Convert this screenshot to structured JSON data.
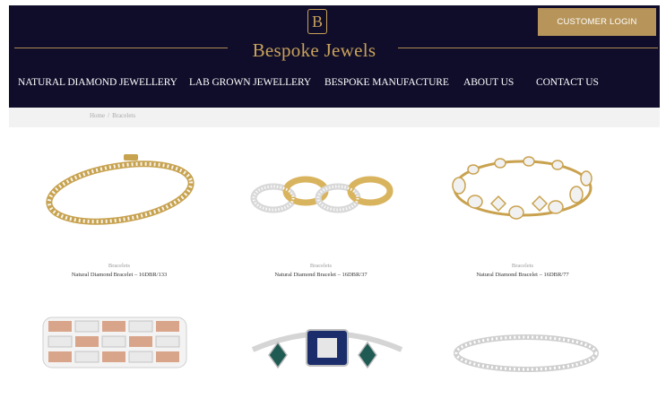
{
  "header": {
    "logo_letter": "B",
    "brand_name": "Bespoke Jewels",
    "login_label": "CUSTOMER LOGIN",
    "background_color": "#0f0d2a",
    "accent_color": "#c9a25a"
  },
  "nav": {
    "items": [
      {
        "label": "NATURAL DIAMOND JEWELLERY"
      },
      {
        "label": "LAB GROWN JEWELLERY"
      },
      {
        "label": "BESPOKE MANUFACTURE"
      },
      {
        "label": "ABOUT US"
      },
      {
        "label": "CONTACT US"
      }
    ]
  },
  "breadcrumb": {
    "home": "Home",
    "separator": "/",
    "current": "Bracelets"
  },
  "products": [
    {
      "category": "Bracelets",
      "name": "Natural Diamond Bracelet – 16DBR/133",
      "metal": "gold",
      "style": "tennis"
    },
    {
      "category": "Bracelets",
      "name": "Natural Diamond Bracelet – 16DBR/37",
      "metal": "two-tone",
      "style": "link"
    },
    {
      "category": "Bracelets",
      "name": "Natural Diamond Bracelet – 16DBR/77",
      "metal": "gold",
      "style": "fancy"
    },
    {
      "metal": "rose-white",
      "style": "panel"
    },
    {
      "metal": "white-sapphire",
      "style": "statement"
    },
    {
      "metal": "white",
      "style": "tennis"
    }
  ]
}
